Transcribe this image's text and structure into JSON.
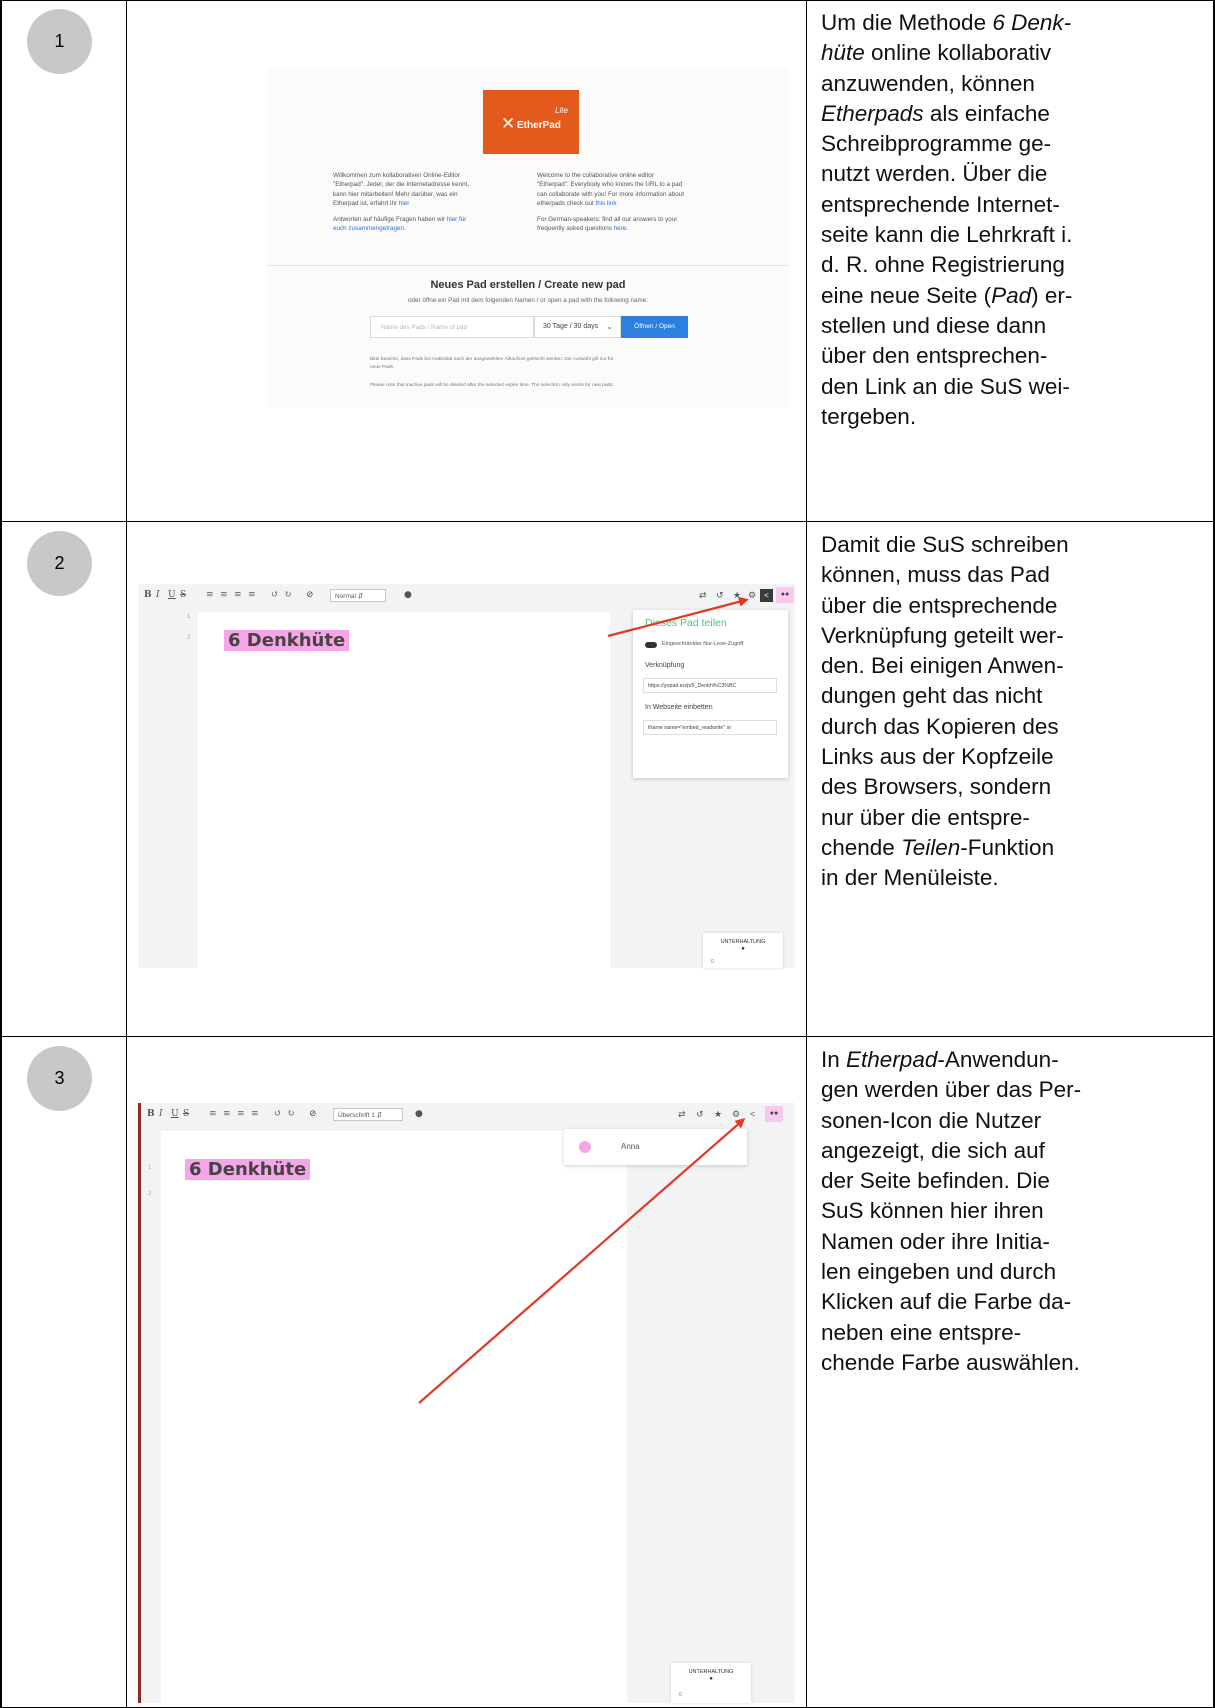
{
  "rows": [
    {
      "number": "1",
      "lines": [
        "Um die Methode |6 Denk-|",
        "|hüte| online kollaborativ",
        "anzuwenden, können",
        "|Etherpads| als einfache",
        "Schreibprogramme ge-",
        "nutzt werden. Über die",
        "entsprechende Internet-",
        "seite kann die Lehrkraft i.",
        "d. R. ohne Registrierung",
        "eine neue Seite (|Pad|) er-",
        "stellen und diese dann",
        "über den entsprechen-",
        "den Link an die SuS wei-",
        "tergeben."
      ],
      "screenshot": {
        "logo_text": "EtherPad",
        "logo_lite": "Lite",
        "intro_de": [
          "Willkommen zum kollaborativen Online-Editor",
          "\"Etherpad\". Jeder, der die Internetadresse kennt,",
          "kann hier mitarbeiten! Mehr darüber, was ein",
          "Etherpad ist, erfahrt ihr "
        ],
        "intro_de_link": "hier",
        "faq_de": "Antworten auf häufige Fragen haben wir ",
        "faq_de_link_1": "hier für",
        "faq_de_link_2": "euch zusammengetragen",
        "intro_en": [
          "Welcome to the collaborative online editor",
          "\"Etherpad\". Everybody who knows the URL to a pad",
          "can collaborate with you! For more information about",
          "etherpads check out "
        ],
        "intro_en_link": "this link",
        "faq_en_1": "For German-speakers: find all our answers to your",
        "faq_en_2": "frequently asked questions ",
        "faq_en_link": "here",
        "create_title": "Neues Pad erstellen / Create new pad",
        "create_subtitle": "oder öffne ein Pad mit dem folgenden Namen / or open a pad with the following name:",
        "name_placeholder": "Name des Pads / Name of pad",
        "expiry_selected": "30 Tage / 30 days",
        "open_button": "Öffnen / Open",
        "note_de_1": "Bitte beachte, dass Pads bei Inaktivität nach der ausgewählten Ablaufzeit gelöscht werden. Die Auswahl gilt nur für",
        "note_de_2": "neue Pads.",
        "note_en": "Please note that inactive pads will be deleted after the selected expire time. The selection only works for new pads."
      }
    },
    {
      "number": "2",
      "lines": [
        "Damit die SuS schreiben",
        "können, muss das Pad",
        "über die entsprechende",
        "Verknüpfung geteilt wer-",
        "den. Bei einigen Anwen-",
        "dungen geht das nicht",
        "durch das Kopieren des",
        "Links aus der Kopfzeile",
        "des Browsers, sondern",
        "nur über die entspre-",
        "chende |Teilen|-Funktion",
        "in der Menüleiste."
      ],
      "screenshot": {
        "style_select": "Normal",
        "heading": "6 Denkhüte",
        "share_title": "Dieses Pad teilen",
        "readonly_label": "Eingeschränkter Nur-Lese-Zugriff",
        "link_label": "Verknüpfung",
        "link_value": "https://yopad.eu/p/6_Denkh%C3%BC",
        "embed_label": "In Webseite einbetten",
        "embed_value": "iframe name=\"embed_readwrite\" sr",
        "chat_label": "UNTERHALTUNG",
        "chat_count": "0"
      }
    },
    {
      "number": "3",
      "lines": [
        "In |Etherpad|-Anwendun-",
        "gen werden über das Per-",
        "sonen-Icon die Nutzer",
        "angezeigt, die sich auf",
        "der Seite befinden. Die",
        "SuS können hier ihren",
        "Namen  oder ihre Initia-",
        "len eingeben und durch",
        "Klicken auf die Farbe da-",
        "neben eine entspre-",
        "chende Farbe auswählen."
      ],
      "screenshot": {
        "style_select": "Überschrift 1",
        "heading": "6 Denkhüte",
        "user_name": "Anna",
        "chat_label": "UNTERHALTUNG",
        "chat_count": "0"
      }
    }
  ]
}
